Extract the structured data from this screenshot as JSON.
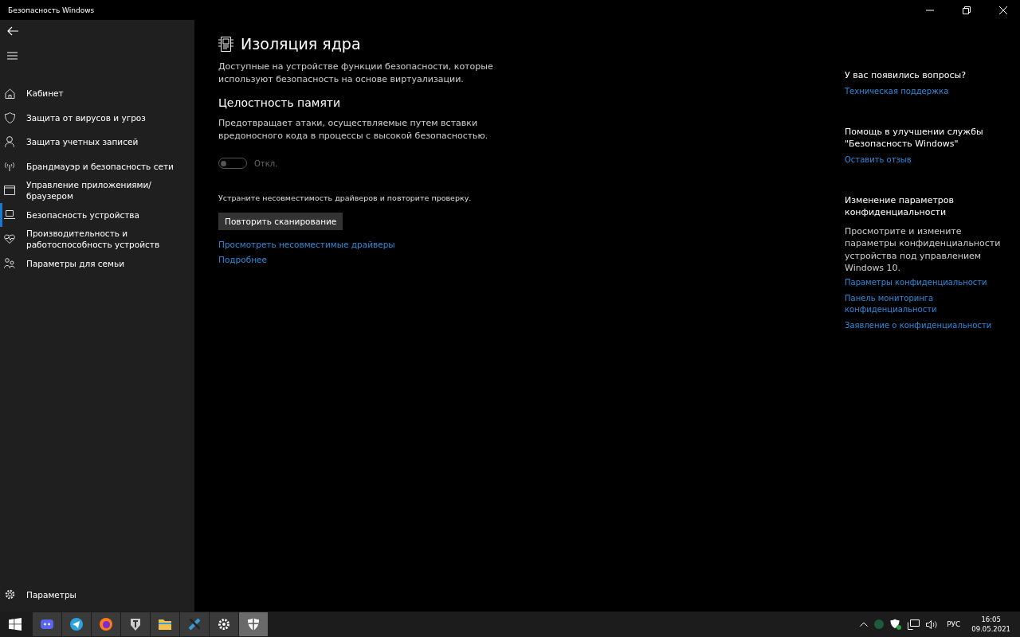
{
  "window": {
    "title": "Безопасность Windows"
  },
  "sidebar": {
    "items": [
      {
        "label": "Кабинет",
        "selected": false,
        "kind": "home"
      },
      {
        "label": "Защита от вирусов и угроз",
        "selected": false,
        "kind": "shield"
      },
      {
        "label": "Защита учетных записей",
        "selected": false,
        "kind": "person"
      },
      {
        "label": "Брандмауэр и безопасность сети",
        "selected": false,
        "kind": "antenna"
      },
      {
        "label": "Управление приложениями/браузером",
        "selected": false,
        "kind": "window"
      },
      {
        "label": "Безопасность устройства",
        "selected": true,
        "kind": "laptop"
      },
      {
        "label": "Производительность и работоспособность устройств",
        "selected": false,
        "kind": "heart"
      },
      {
        "label": "Параметры для семьи",
        "selected": false,
        "kind": "family"
      }
    ],
    "settings": "Параметры"
  },
  "page": {
    "title": "Изоляция ядра",
    "description": "Доступные на устройстве функции безопасности, которые используют безопасность на основе виртуализации.",
    "section": {
      "title": "Целостность памяти",
      "description": "Предотвращает атаки, осуществляемые путем вставки вредоносного кода в процессы с высокой безопасностью.",
      "toggle": {
        "on": false,
        "disabled": true,
        "label": "Откл."
      }
    },
    "warning": "Устраните несовместимость драйверов и повторите проверку.",
    "button": "Повторить сканирование",
    "links": [
      "Просмотреть несовместимые драйверы",
      "Подробнее"
    ]
  },
  "aside": [
    {
      "heading": "У вас появились вопросы?",
      "links": [
        "Техническая поддержка"
      ]
    },
    {
      "heading": "Помощь в улучшении службы \"Безопасность Windows\"",
      "links": [
        "Оставить отзыв"
      ]
    },
    {
      "heading": "Изменение параметров конфиденциальности",
      "text": "Просмотрите и измените параметры конфиденциальности устройства под управлением Windows 10.",
      "links": [
        "Параметры конфиденциальности",
        "Панель мониторинга конфиденциальности",
        "Заявление о конфиденциальности"
      ]
    }
  ],
  "taskbar": {
    "apps": [
      {
        "selected": false
      },
      {
        "selected": false
      },
      {
        "selected": false
      },
      {
        "selected": false
      },
      {
        "selected": false
      },
      {
        "selected": false
      },
      {
        "selected": false
      },
      {
        "selected": true
      }
    ],
    "language": "РУС",
    "time": "16:05",
    "date": "09.05.2021"
  }
}
